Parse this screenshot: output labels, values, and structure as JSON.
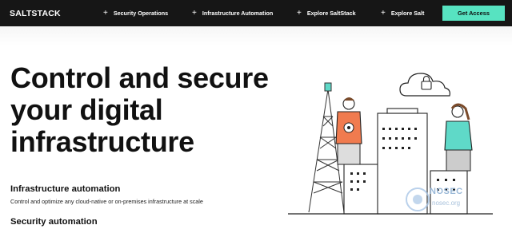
{
  "header": {
    "logo": "SALTSTACK",
    "nav": [
      {
        "label": "Security Operations",
        "icon": "plus-icon"
      },
      {
        "label": "Infrastructure Automation",
        "icon": "plus-icon"
      },
      {
        "label": "Explore SaltStack",
        "icon": "plus-icon"
      },
      {
        "label": "Explore Salt",
        "icon": "plus-icon"
      }
    ],
    "cta_label": "Get Access"
  },
  "hero": {
    "headline": "Control and secure your digital infrastructure"
  },
  "sections": [
    {
      "title": "Infrastructure automation",
      "text": "Control and optimize any cloud-native or on-premises infrastructure at scale"
    },
    {
      "title": "Security automation"
    }
  ],
  "watermark": {
    "text": "NOSEC",
    "sub": "nosec.org"
  },
  "colors": {
    "accent": "#57e3c1",
    "topbar": "#161616",
    "illustration_orange": "#f07b4f",
    "illustration_teal": "#5fd9c8"
  }
}
